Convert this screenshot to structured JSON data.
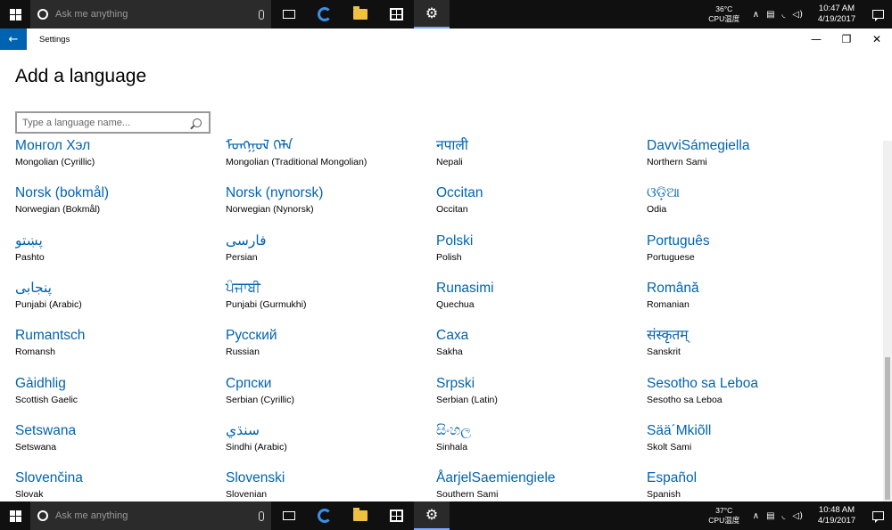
{
  "taskbar_top": {
    "search_placeholder": "Ask me anything",
    "temp": "36°C",
    "cpu_label": "CPU温度",
    "time": "10:47 AM",
    "date": "4/19/2017"
  },
  "taskbar_bottom": {
    "search_placeholder": "Ask me anything",
    "temp": "37°C",
    "cpu_label": "CPU温度",
    "time": "10:48 AM",
    "date": "4/19/2017"
  },
  "window": {
    "title": "Settings",
    "back_glyph": "←",
    "minimize_glyph": "—",
    "restore_glyph": "❐",
    "close_glyph": "✕"
  },
  "page": {
    "title": "Add a language",
    "search_placeholder": "Type a language name..."
  },
  "languages": [
    {
      "native": "Монгол Хэл",
      "english": "Mongolian (Cyrillic)"
    },
    {
      "native": "ᠮᠣᠩᠭᠣᠯ ᠬᠡᠯᠡ",
      "english": "Mongolian (Traditional Mongolian)"
    },
    {
      "native": "नपाली",
      "english": "Nepali"
    },
    {
      "native": "DavviSámegiella",
      "english": "Northern Sami"
    },
    {
      "native": "Norsk (bokmål)",
      "english": "Norwegian (Bokmål)"
    },
    {
      "native": "Norsk (nynorsk)",
      "english": "Norwegian (Nynorsk)"
    },
    {
      "native": "Occitan",
      "english": "Occitan"
    },
    {
      "native": "ଓଡ଼ିଆ",
      "english": "Odia"
    },
    {
      "native": "پښتو",
      "english": "Pashto"
    },
    {
      "native": "فارسى",
      "english": "Persian"
    },
    {
      "native": "Polski",
      "english": "Polish"
    },
    {
      "native": "Português",
      "english": "Portuguese"
    },
    {
      "native": "پنجابی",
      "english": "Punjabi (Arabic)"
    },
    {
      "native": "ਪੰਜਾਬੀ",
      "english": "Punjabi (Gurmukhi)"
    },
    {
      "native": "Runasimi",
      "english": "Quechua"
    },
    {
      "native": "Română",
      "english": "Romanian"
    },
    {
      "native": "Rumantsch",
      "english": "Romansh"
    },
    {
      "native": "Русский",
      "english": "Russian"
    },
    {
      "native": "Саха",
      "english": "Sakha"
    },
    {
      "native": "संस्कृतम्",
      "english": "Sanskrit"
    },
    {
      "native": "Gàidhlig",
      "english": "Scottish Gaelic"
    },
    {
      "native": "Српски",
      "english": "Serbian (Cyrillic)"
    },
    {
      "native": "Srpski",
      "english": "Serbian (Latin)"
    },
    {
      "native": "Sesotho sa Leboa",
      "english": "Sesotho sa Leboa"
    },
    {
      "native": "Setswana",
      "english": "Setswana"
    },
    {
      "native": "سنڌي",
      "english": "Sindhi (Arabic)"
    },
    {
      "native": "සිංහල",
      "english": "Sinhala"
    },
    {
      "native": "Sää´Mkiõll",
      "english": "Skolt Sami"
    },
    {
      "native": "Slovenčina",
      "english": "Slovak"
    },
    {
      "native": "Slovenski",
      "english": "Slovenian"
    },
    {
      "native": "ÅarjelSaemiengiele",
      "english": "Southern Sami"
    },
    {
      "native": "Español",
      "english": "Spanish"
    }
  ]
}
